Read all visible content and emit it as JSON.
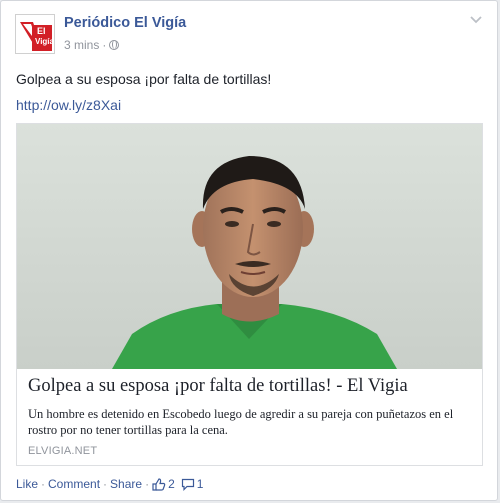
{
  "post": {
    "page_name": "Periódico El Vigía",
    "time": "3 mins",
    "separator": "·",
    "text": "Golpea a su esposa ¡por falta de tortillas!",
    "link": "http://ow.ly/z8Xai"
  },
  "logo": {
    "line1": "El",
    "line2": "Vigía"
  },
  "attachment": {
    "title": "Golpea a su esposa ¡por falta de tortillas! - El Vigia",
    "description": "Un hombre es detenido en Escobedo luego de agredir a su pareja con puñetazos en el rostro por no tener tortillas para la cena.",
    "domain": "ELVIGIA.NET"
  },
  "actions": {
    "like": "Like",
    "comment": "Comment",
    "share": "Share",
    "separator": "·",
    "likes_count": "2",
    "comments_count": "1"
  },
  "icons": {
    "privacy": "globe-icon",
    "menu": "chevron-down-icon",
    "likes": "thumbs-up-icon",
    "comments": "comment-icon"
  },
  "colors": {
    "link": "#3b5998",
    "muted": "#90949c",
    "text": "#1d2129",
    "brand_red": "#d21f26",
    "shirt_green": "#37a34a"
  }
}
